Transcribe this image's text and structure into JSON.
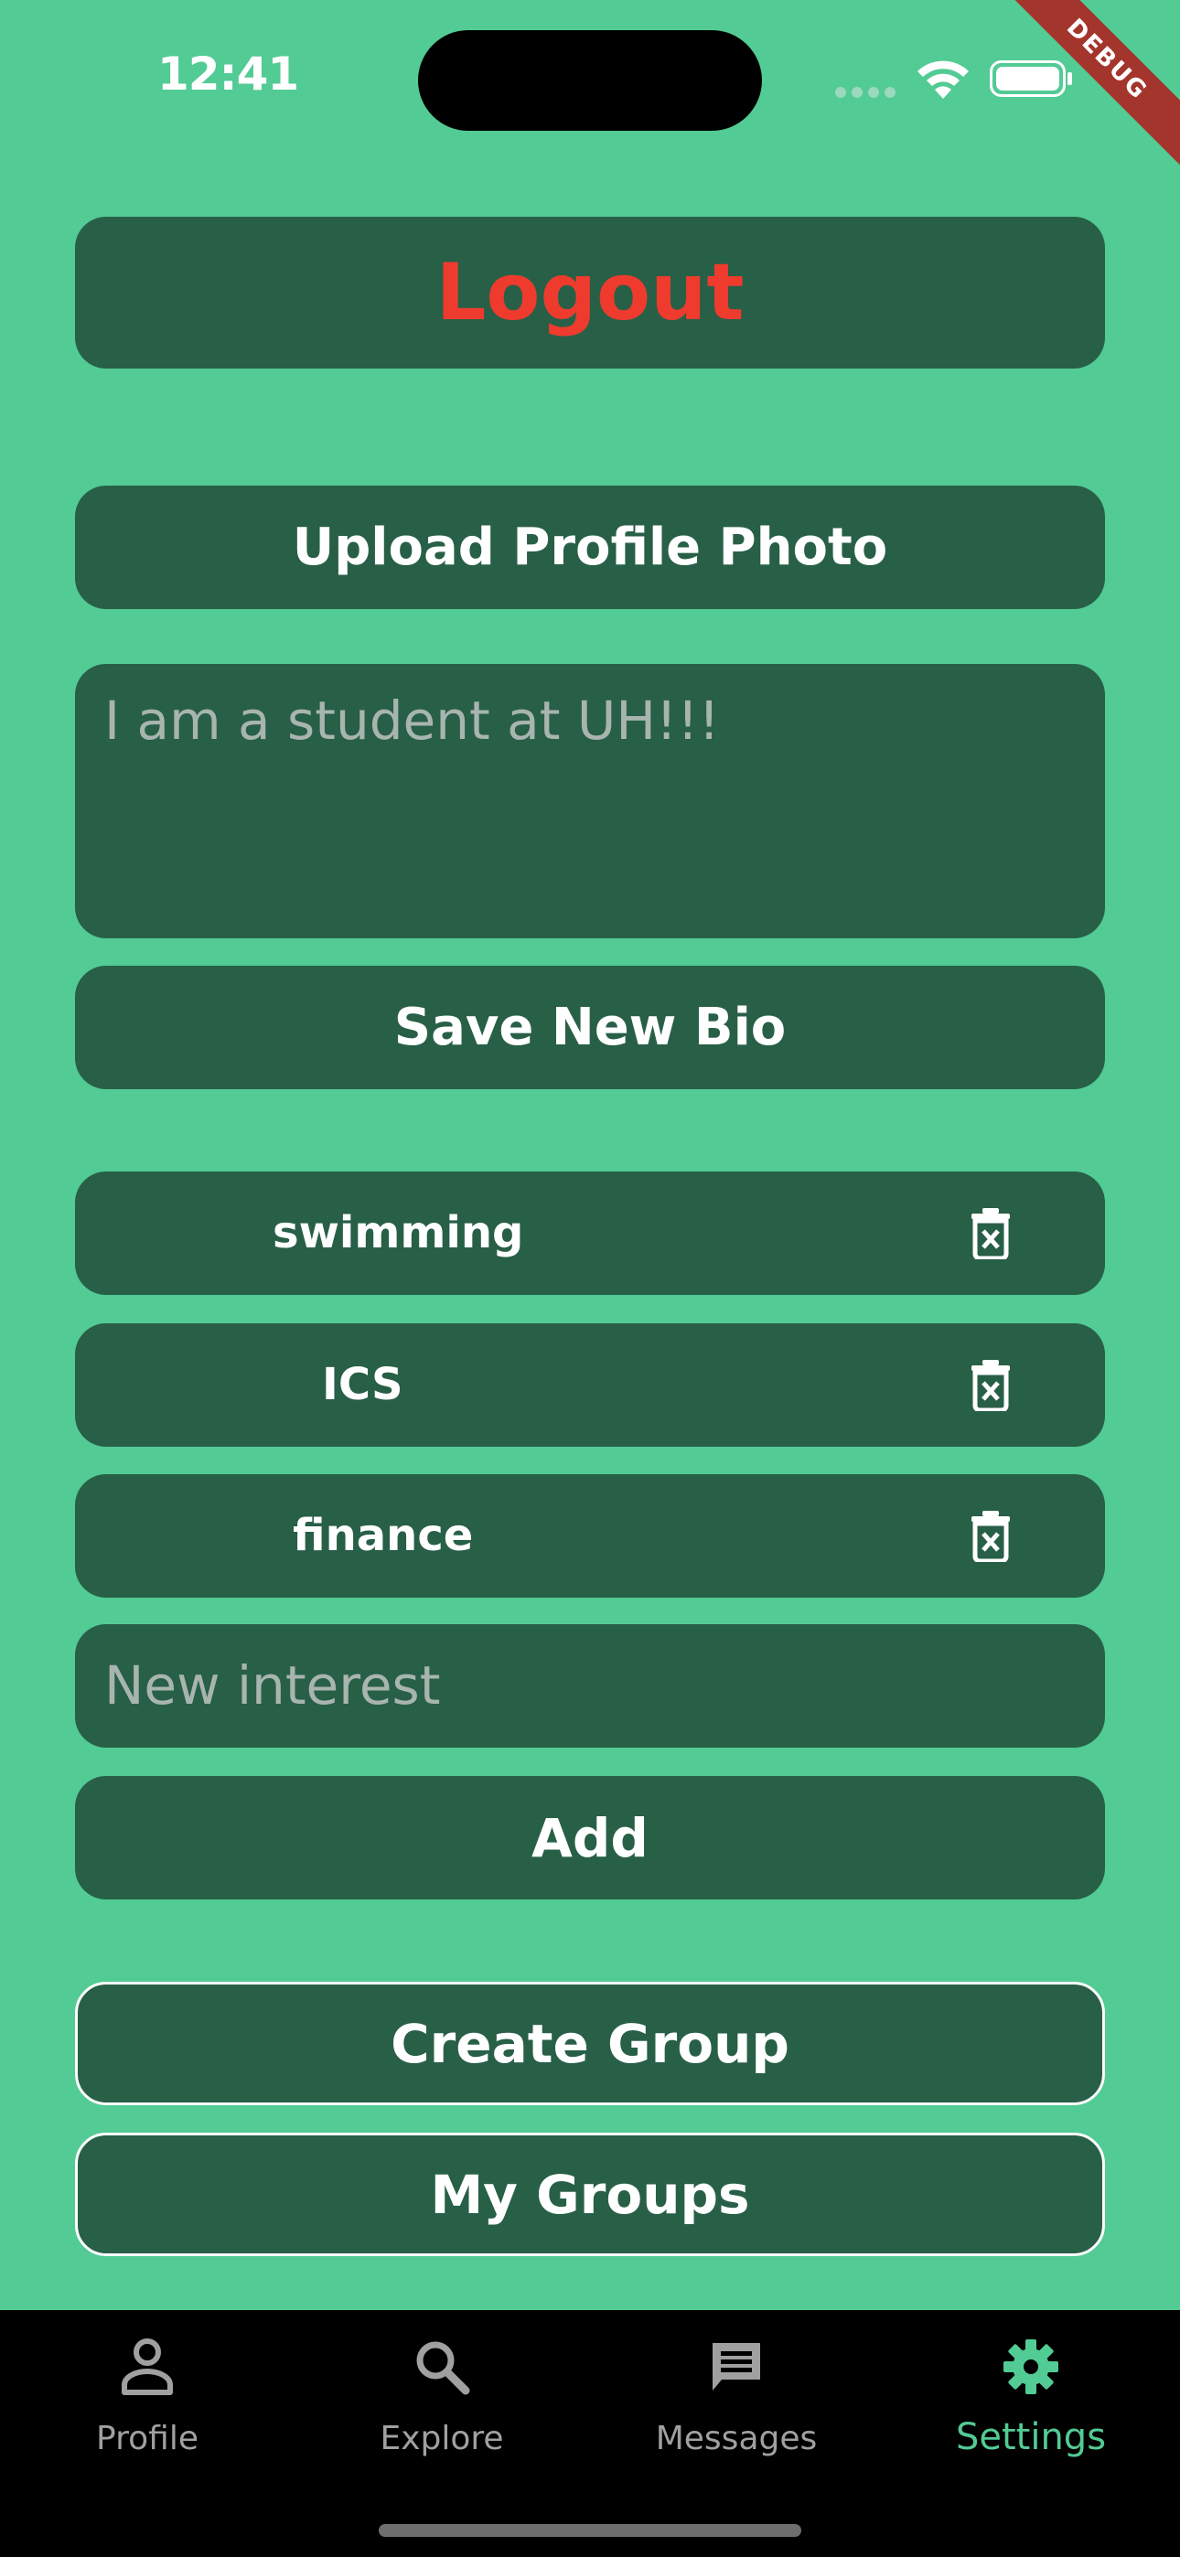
{
  "status_bar": {
    "time": "12:41",
    "debug_label": "DEBUG"
  },
  "settings": {
    "logout_label": "Logout",
    "upload_photo_label": "Upload Profile Photo",
    "bio_placeholder": "I am a student at UH!!!",
    "save_bio_label": "Save New Bio",
    "interests": [
      {
        "label": "swimming"
      },
      {
        "label": "ICS"
      },
      {
        "label": "finance"
      }
    ],
    "new_interest_placeholder": "New interest",
    "add_label": "Add",
    "create_group_label": "Create Group",
    "my_groups_label": "My Groups"
  },
  "bottom_nav": {
    "items": [
      {
        "label": "Profile",
        "icon": "person-icon"
      },
      {
        "label": "Explore",
        "icon": "search-icon"
      },
      {
        "label": "Messages",
        "icon": "message-icon"
      },
      {
        "label": "Settings",
        "icon": "gear-icon",
        "active": true
      }
    ]
  },
  "colors": {
    "background": "#52CB94",
    "button": "#285F47",
    "logout_text": "#EE3B2E",
    "placeholder": "#A8B5AF",
    "nav_active": "#52CB94",
    "nav_inactive": "#A0A0A0"
  }
}
